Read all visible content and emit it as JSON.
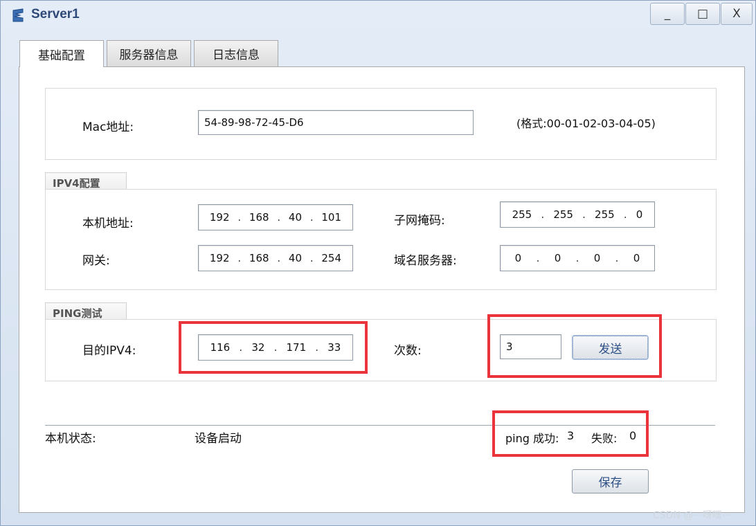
{
  "window": {
    "title": "Server1",
    "controls": {
      "minimize": "_",
      "maximize": "□",
      "close": "X"
    }
  },
  "tabs": [
    {
      "label": "基础配置",
      "active": true
    },
    {
      "label": "服务器信息",
      "active": false
    },
    {
      "label": "日志信息",
      "active": false
    }
  ],
  "mac": {
    "label": "Mac地址:",
    "value": "54-89-98-72-45-D6",
    "format_hint": "(格式:00-01-02-03-04-05)"
  },
  "ipv4": {
    "group_title": "IPV4配置",
    "local_address": {
      "label": "本机地址:",
      "octets": [
        "192",
        "168",
        "40",
        "101"
      ]
    },
    "subnet_mask": {
      "label": "子网掩码:",
      "octets": [
        "255",
        "255",
        "255",
        "0"
      ]
    },
    "gateway": {
      "label": "网关:",
      "octets": [
        "192",
        "168",
        "40",
        "254"
      ]
    },
    "dns": {
      "label": "域名服务器:",
      "octets": [
        "0",
        "0",
        "0",
        "0"
      ]
    }
  },
  "ping": {
    "group_title": "PING测试",
    "dest_label": "目的IPV4:",
    "dest_octets": [
      "116",
      "32",
      "171",
      "33"
    ],
    "count_label": "次数:",
    "count_value": "3",
    "send_label": "发送"
  },
  "status": {
    "label": "本机状态:",
    "value": "设备启动",
    "ping_success_label": "ping 成功:",
    "ping_success_value": "3",
    "ping_fail_label": "失败:",
    "ping_fail_value": "0"
  },
  "save_label": "保存",
  "watermark": "CSDN @···呀嘿···",
  "colors": {
    "highlight": "#e8343a",
    "title": "#2f4a78"
  }
}
